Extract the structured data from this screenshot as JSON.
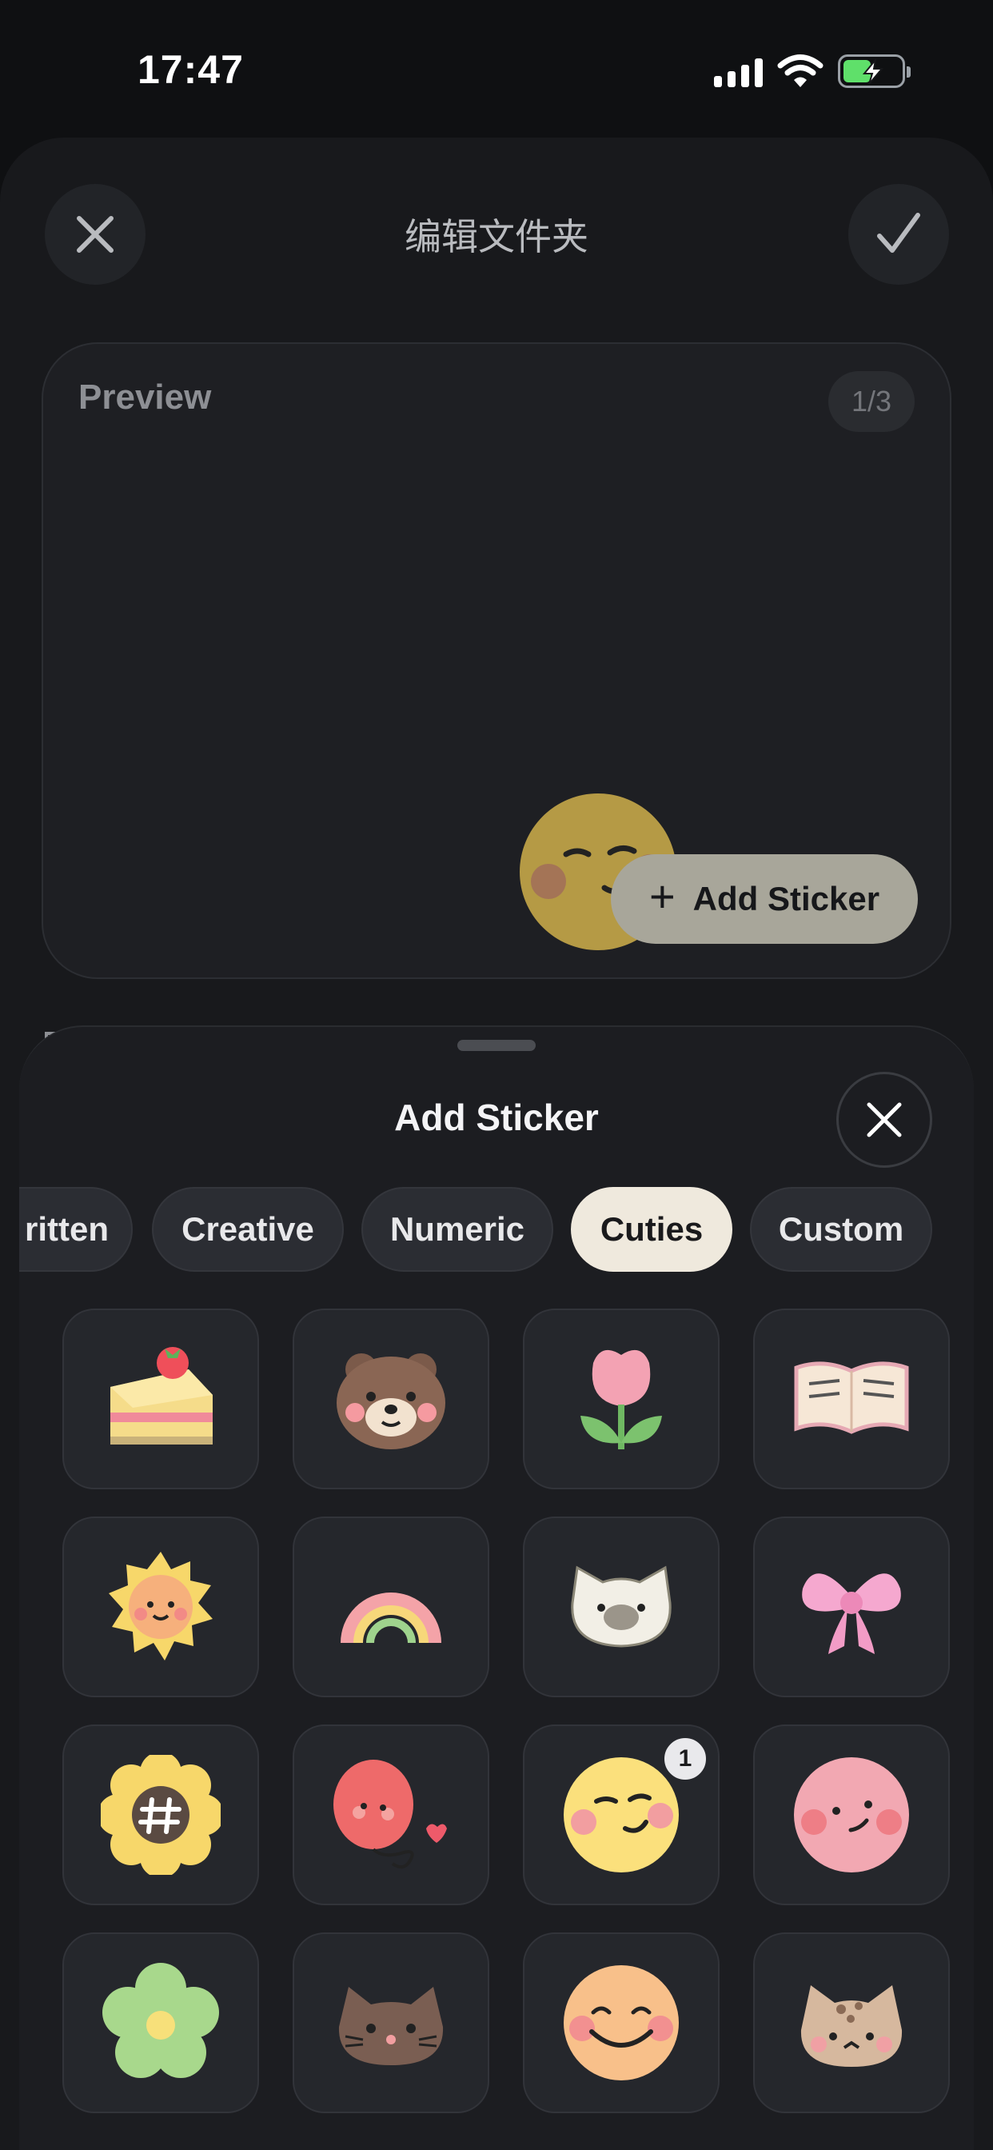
{
  "status_bar": {
    "time": "17:47"
  },
  "edit_folder": {
    "title": "编辑文件夹"
  },
  "preview": {
    "label": "Preview",
    "page": "1/3",
    "add_sticker_label": "Add Sticker"
  },
  "sticker_sheet": {
    "title": "Add Sticker",
    "tabs": [
      {
        "label": "Handwritten",
        "visible_label": "ritten",
        "selected": false
      },
      {
        "label": "Creative",
        "selected": false
      },
      {
        "label": "Numeric",
        "selected": false
      },
      {
        "label": "Cuties",
        "selected": true
      },
      {
        "label": "Custom",
        "selected": false
      }
    ],
    "stickers": [
      {
        "name": "strawberry-cake"
      },
      {
        "name": "bear"
      },
      {
        "name": "tulip"
      },
      {
        "name": "open-book"
      },
      {
        "name": "sun"
      },
      {
        "name": "rainbow"
      },
      {
        "name": "white-cat"
      },
      {
        "name": "pink-bow"
      },
      {
        "name": "hash-flower"
      },
      {
        "name": "red-balloon"
      },
      {
        "name": "smirk-face",
        "count": "1"
      },
      {
        "name": "pink-face"
      },
      {
        "name": "green-flower"
      },
      {
        "name": "brown-cat"
      },
      {
        "name": "smile-face"
      },
      {
        "name": "shiba-dog"
      }
    ]
  },
  "colors": {
    "accent_button": "#a8a69a",
    "selected_tab": "#efe9dd",
    "sheet_bg": "#1c1d21"
  }
}
